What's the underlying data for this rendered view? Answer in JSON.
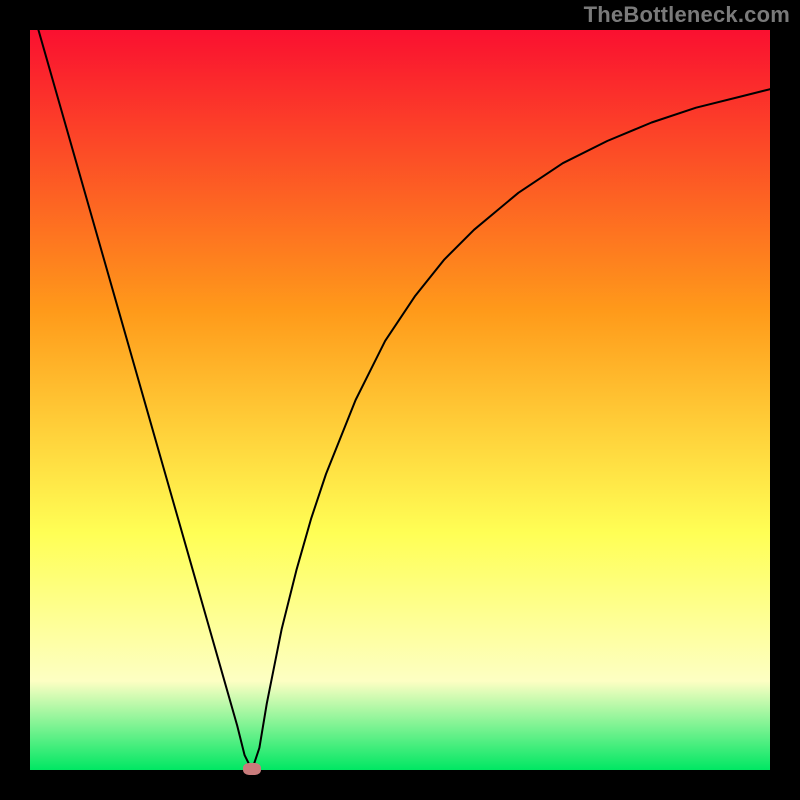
{
  "watermark": "TheBottleneck.com",
  "colors": {
    "black": "#000000",
    "red": "#fa1030",
    "orange": "#ff9a1a",
    "yellow": "#ffff55",
    "paleyellow": "#fdffc3",
    "green": "#00e763",
    "curve": "#000000",
    "marker": "#c97b7b"
  },
  "chart_data": {
    "type": "line",
    "title": "",
    "xlabel": "",
    "ylabel": "",
    "xlim": [
      0,
      100
    ],
    "ylim": [
      0,
      100
    ],
    "grid": false,
    "series": [
      {
        "name": "bottleneck-curve",
        "x": [
          0,
          2,
          4,
          6,
          8,
          10,
          12,
          14,
          16,
          18,
          20,
          22,
          24,
          26,
          28,
          29,
          30,
          31,
          32,
          34,
          36,
          38,
          40,
          44,
          48,
          52,
          56,
          60,
          66,
          72,
          78,
          84,
          90,
          96,
          100
        ],
        "y": [
          104,
          97,
          90,
          83,
          76,
          69,
          62,
          55,
          48,
          41,
          34,
          27,
          20,
          13,
          6,
          2,
          0,
          3,
          9,
          19,
          27,
          34,
          40,
          50,
          58,
          64,
          69,
          73,
          78,
          82,
          85,
          87.5,
          89.5,
          91,
          92
        ]
      }
    ],
    "marker": {
      "x": 30,
      "y": 0
    }
  }
}
